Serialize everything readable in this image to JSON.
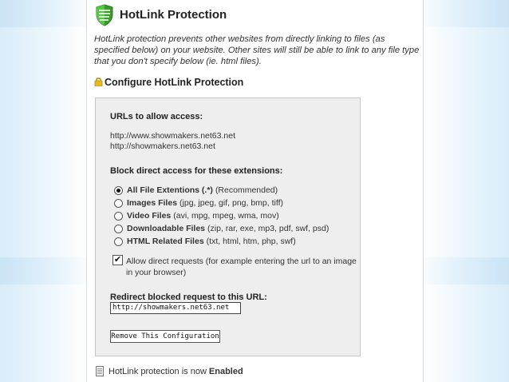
{
  "header": {
    "title": "HotLink Protection"
  },
  "description": "HotLink protection prevents other websites from directly linking to files (as specified below) on your website. Other sites will still be able to link to any file type that you don't specify below (ie. html files).",
  "config_heading": "Configure HotLink Protection",
  "allow": {
    "label": "URLs to allow access:",
    "urls": [
      "http://www.showmakers.net63.net",
      "http://showmakers.net63.net"
    ]
  },
  "block": {
    "label": "Block direct access for these extensions:",
    "options": [
      {
        "name": "All File Extentions (.*)",
        "detail": "(Recommended)",
        "selected": true
      },
      {
        "name": "Images Files",
        "detail": "(jpg, jpeg, gif, png, bmp, tiff)",
        "selected": false
      },
      {
        "name": "Video Files",
        "detail": "(avi, mpg, mpeg, wma, mov)",
        "selected": false
      },
      {
        "name": "Downloadable Files",
        "detail": "(zip, rar, exe, mp3, pdf, swf, psd)",
        "selected": false
      },
      {
        "name": "HTML Related Files",
        "detail": "(txt, html, htm, php, swf)",
        "selected": false
      }
    ]
  },
  "allow_direct": {
    "checked": true,
    "text": "Allow direct requests (for example entering the url to an image in your browser)"
  },
  "redirect": {
    "label": "Redirect blocked request to this URL:",
    "value": "http://showmakers.net63.net"
  },
  "remove_button": "Remove This Configuration",
  "status": {
    "prefix": "HotLink protection is now",
    "state": "Enabled"
  },
  "colors": {
    "shield_green": "#3a9a2a",
    "lock_gold": "#e8b820",
    "box_bg": "#eeeeee"
  },
  "icons": [
    "shield-icon",
    "lock-icon",
    "document-icon"
  ]
}
